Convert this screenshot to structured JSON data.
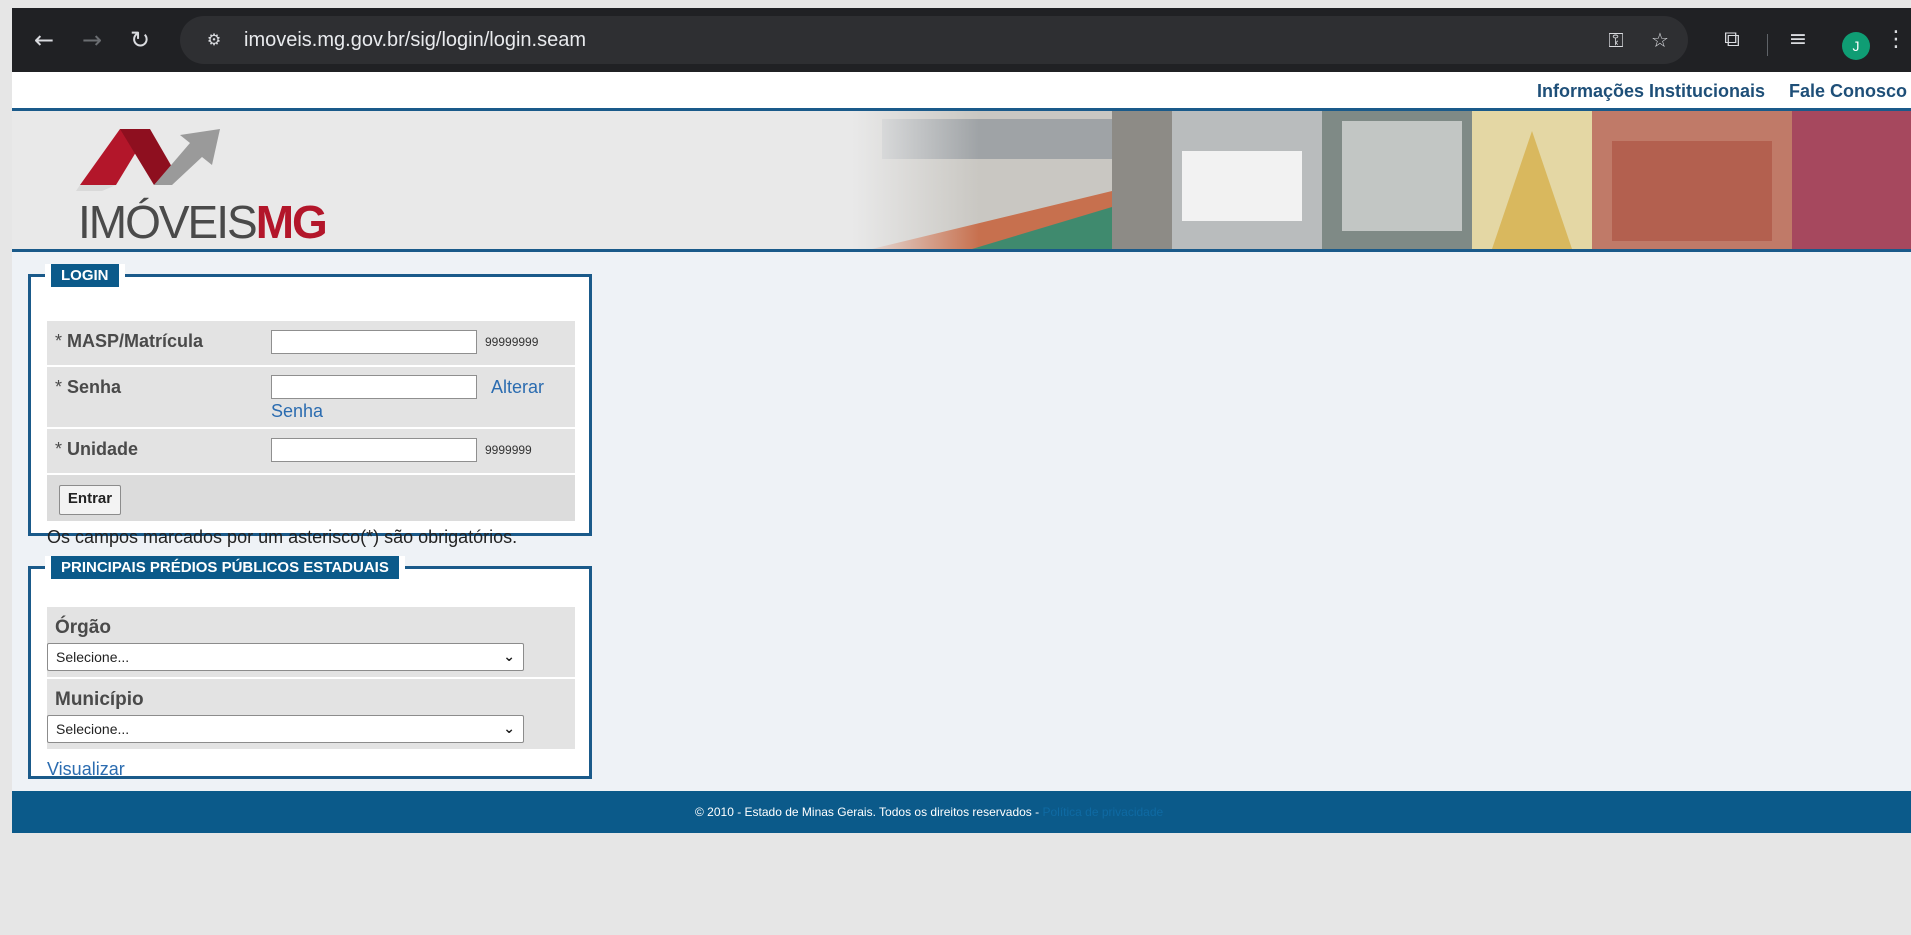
{
  "browser": {
    "url": "imoveis.mg.gov.br/sig/login/login.seam",
    "back_icon": "arrow-left-icon",
    "forward_icon": "arrow-right-icon",
    "reload_icon": "reload-icon",
    "avatar_letter": "J"
  },
  "top_links": [
    "Informações Institucionais",
    "Fale Conosco"
  ],
  "logo": {
    "part1": "IMÓVEIS",
    "part2": "MG"
  },
  "login": {
    "legend": "LOGIN",
    "masp": {
      "label": "MASP/Matrícula",
      "hint": "99999999",
      "value": ""
    },
    "senha": {
      "label": "Senha",
      "alterar_link": "Alterar",
      "senha_link": "Senha",
      "value": ""
    },
    "unidade": {
      "label": "Unidade",
      "hint": "9999999",
      "value": ""
    },
    "submit_label": "Entrar",
    "required_note": "Os campos marcados por um asterisco(*) são obrigatórios.",
    "asterisk": "*"
  },
  "predios": {
    "legend": "PRINCIPAIS PRÉDIOS PÚBLICOS ESTADUAIS",
    "orgao_label": "Órgão",
    "orgao_selected": "Selecione...",
    "municipio_label": "Município",
    "municipio_selected": "Selecione...",
    "visualizar_link": "Visualizar"
  },
  "footer": {
    "copyright": "© 2010 - Estado de Minas Gerais. Todos os direitos reservados -",
    "link": "Política de privacidade"
  },
  "colors": {
    "brand_blue": "#0b5a8a",
    "logo_red": "#b3162a",
    "link": "#2b6cb0"
  }
}
